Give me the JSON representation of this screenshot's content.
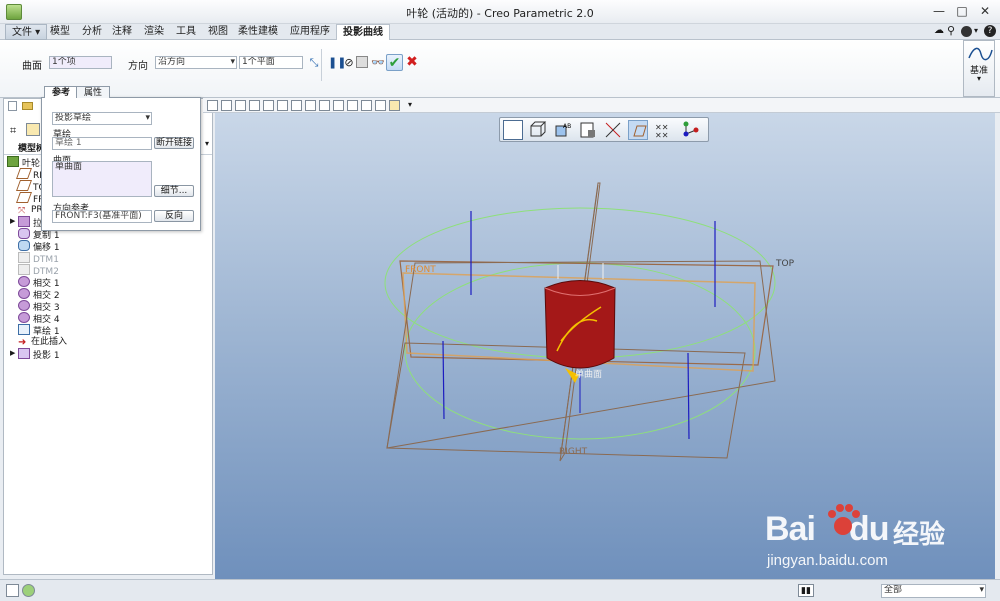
{
  "window": {
    "title": "叶轮 (活动的) - Creo Parametric 2.0",
    "min_glyph": "—",
    "max_glyph": "□",
    "close_glyph": "✕"
  },
  "ribbon": {
    "tabs": [
      {
        "label": "文件"
      },
      {
        "label": "模型"
      },
      {
        "label": "分析"
      },
      {
        "label": "注释"
      },
      {
        "label": "渲染"
      },
      {
        "label": "工具"
      },
      {
        "label": "视图"
      },
      {
        "label": "柔性建模"
      },
      {
        "label": "应用程序"
      },
      {
        "label": "投影曲线"
      }
    ],
    "surface_label": "曲面",
    "surface_value": "1个项",
    "direction_label": "方向",
    "direction_value": "沿方向",
    "plane_value": "1个平面",
    "datum_label": "基准",
    "colors": {
      "accent": "#2c6ab0",
      "ok": "#2e9e3a",
      "cancel": "#d21f1f"
    }
  },
  "popup": {
    "tab_ref": "参考",
    "tab_props": "属性",
    "mode_value": "投影草绘",
    "sketch_label": "草绘",
    "sketch_value": "草绘 1",
    "break_link_button": "断开链接",
    "surface_label": "曲面",
    "surface_item": "单曲面",
    "details_button": "细节...",
    "dir_ref_label": "方向参考",
    "dir_ref_value": "FRONT:F3(基准平面)",
    "reverse_button": "反向"
  },
  "tree": {
    "header": "模型树",
    "items": [
      {
        "label": "叶轮.PR"
      },
      {
        "label": "RIG"
      },
      {
        "label": "TOP"
      },
      {
        "label": "FRO"
      },
      {
        "label": "PRT"
      },
      {
        "label": "拉伸"
      },
      {
        "label": "复制 1"
      },
      {
        "label": "偏移 1"
      },
      {
        "label": "DTM1"
      },
      {
        "label": "DTM2"
      },
      {
        "label": "相交 1"
      },
      {
        "label": "相交 2"
      },
      {
        "label": "相交 3"
      },
      {
        "label": "相交 4"
      },
      {
        "label": "草绘 1"
      },
      {
        "label": "在此插入"
      },
      {
        "label": "投影 1"
      }
    ]
  },
  "viewport": {
    "labels": {
      "top": "TOP",
      "right": "RIGHT",
      "front": "FRONT",
      "surface": "单曲面"
    }
  },
  "status": {
    "filter_value": "全部"
  },
  "watermark": {
    "brand": "Bai",
    "brand2": "du",
    "cn": "经验",
    "url": "jingyan.baidu.com"
  }
}
